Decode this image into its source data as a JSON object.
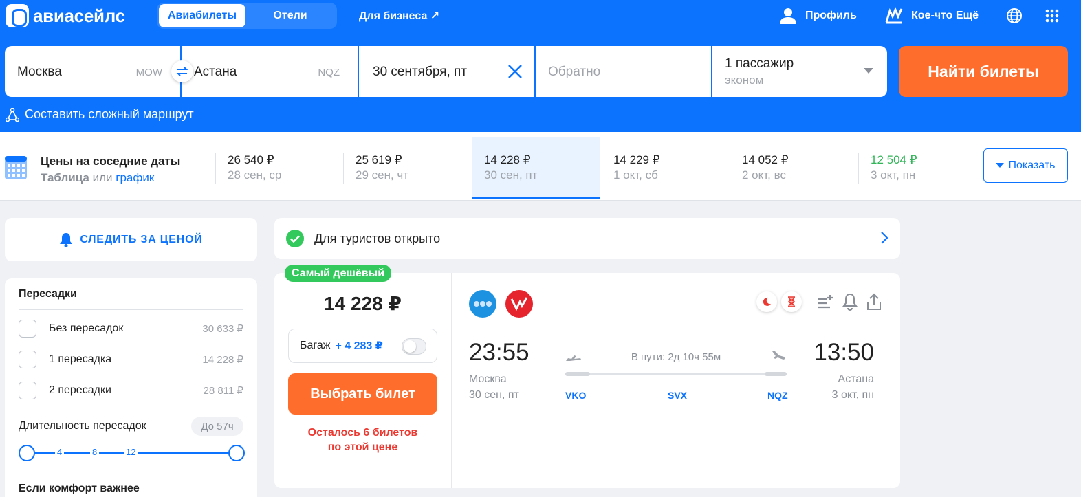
{
  "header": {
    "logo": "авиасейлс",
    "tabs": [
      {
        "label": "Авиабилеты",
        "active": true
      },
      {
        "label": "Отели",
        "active": false
      }
    ],
    "business": "Для бизнеса ↗",
    "profile": "Профиль",
    "more": "Кое-что Ещё"
  },
  "search": {
    "from_city": "Москва",
    "from_code": "MOW",
    "to_city": "Астана",
    "to_code": "NQZ",
    "date": "30 сентября, пт",
    "return_placeholder": "Обратно",
    "passengers": "1 пассажир",
    "cabin": "эконом",
    "find_button": "Найти билеты",
    "complex_route": "Составить сложный маршрут"
  },
  "dates_strip": {
    "title": "Цены на соседние даты",
    "table_link": "Таблица",
    "or": "или",
    "chart_link": "график",
    "days": [
      {
        "price": "26 540 ₽",
        "date": "28 сен, ср",
        "selected": false
      },
      {
        "price": "25 619 ₽",
        "date": "29 сен, чт",
        "selected": false
      },
      {
        "price": "14 228 ₽",
        "date": "30 сен, пт",
        "selected": true
      },
      {
        "price": "14 229 ₽",
        "date": "1 окт, сб",
        "selected": false
      },
      {
        "price": "14 052 ₽",
        "date": "2 окт, вс",
        "selected": false
      },
      {
        "price": "12 504 ₽",
        "date": "3 окт, пн",
        "selected": false
      }
    ],
    "show_button": "Показать",
    "cheapest_color": "#33b559"
  },
  "filters": {
    "track_price": "СЛЕДИТЬ ЗА ЦЕНОЙ",
    "stops_title": "Пересадки",
    "stops": [
      {
        "label": "Без пересадок",
        "price": "30 633 ₽"
      },
      {
        "label": "1 пересадка",
        "price": "14 228 ₽"
      },
      {
        "label": "2 пересадки",
        "price": "28 811 ₽"
      }
    ],
    "duration_label": "Длительность пересадок",
    "duration_max": "До 57ч",
    "slider_ticks": [
      "4",
      "8",
      "12"
    ],
    "comfort_title": "Если комфорт важнее"
  },
  "tourists": {
    "text": "Для туристов открыто"
  },
  "ticket": {
    "badge": "Самый дешёвый",
    "price": "14 228 ₽",
    "baggage_label": "Багаж",
    "baggage_price": "+ 4 283 ₽",
    "choose_button": "Выбрать билет",
    "tickets_left_1": "Осталось 6 билетов",
    "tickets_left_2": "по этой цене",
    "dep_time": "23:55",
    "arr_time": "13:50",
    "dep_city": "Москва",
    "dep_date": "30 сен, пт",
    "arr_city": "Астана",
    "arr_date": "3 окт, пн",
    "duration": "В пути: 2д 10ч 55м",
    "airports": [
      "VKO",
      "SVX",
      "NQZ"
    ]
  },
  "colors": {
    "brand": "#0c73fe",
    "accent": "#ff6d2d",
    "green": "#33c95c",
    "danger": "#ec3a32"
  }
}
